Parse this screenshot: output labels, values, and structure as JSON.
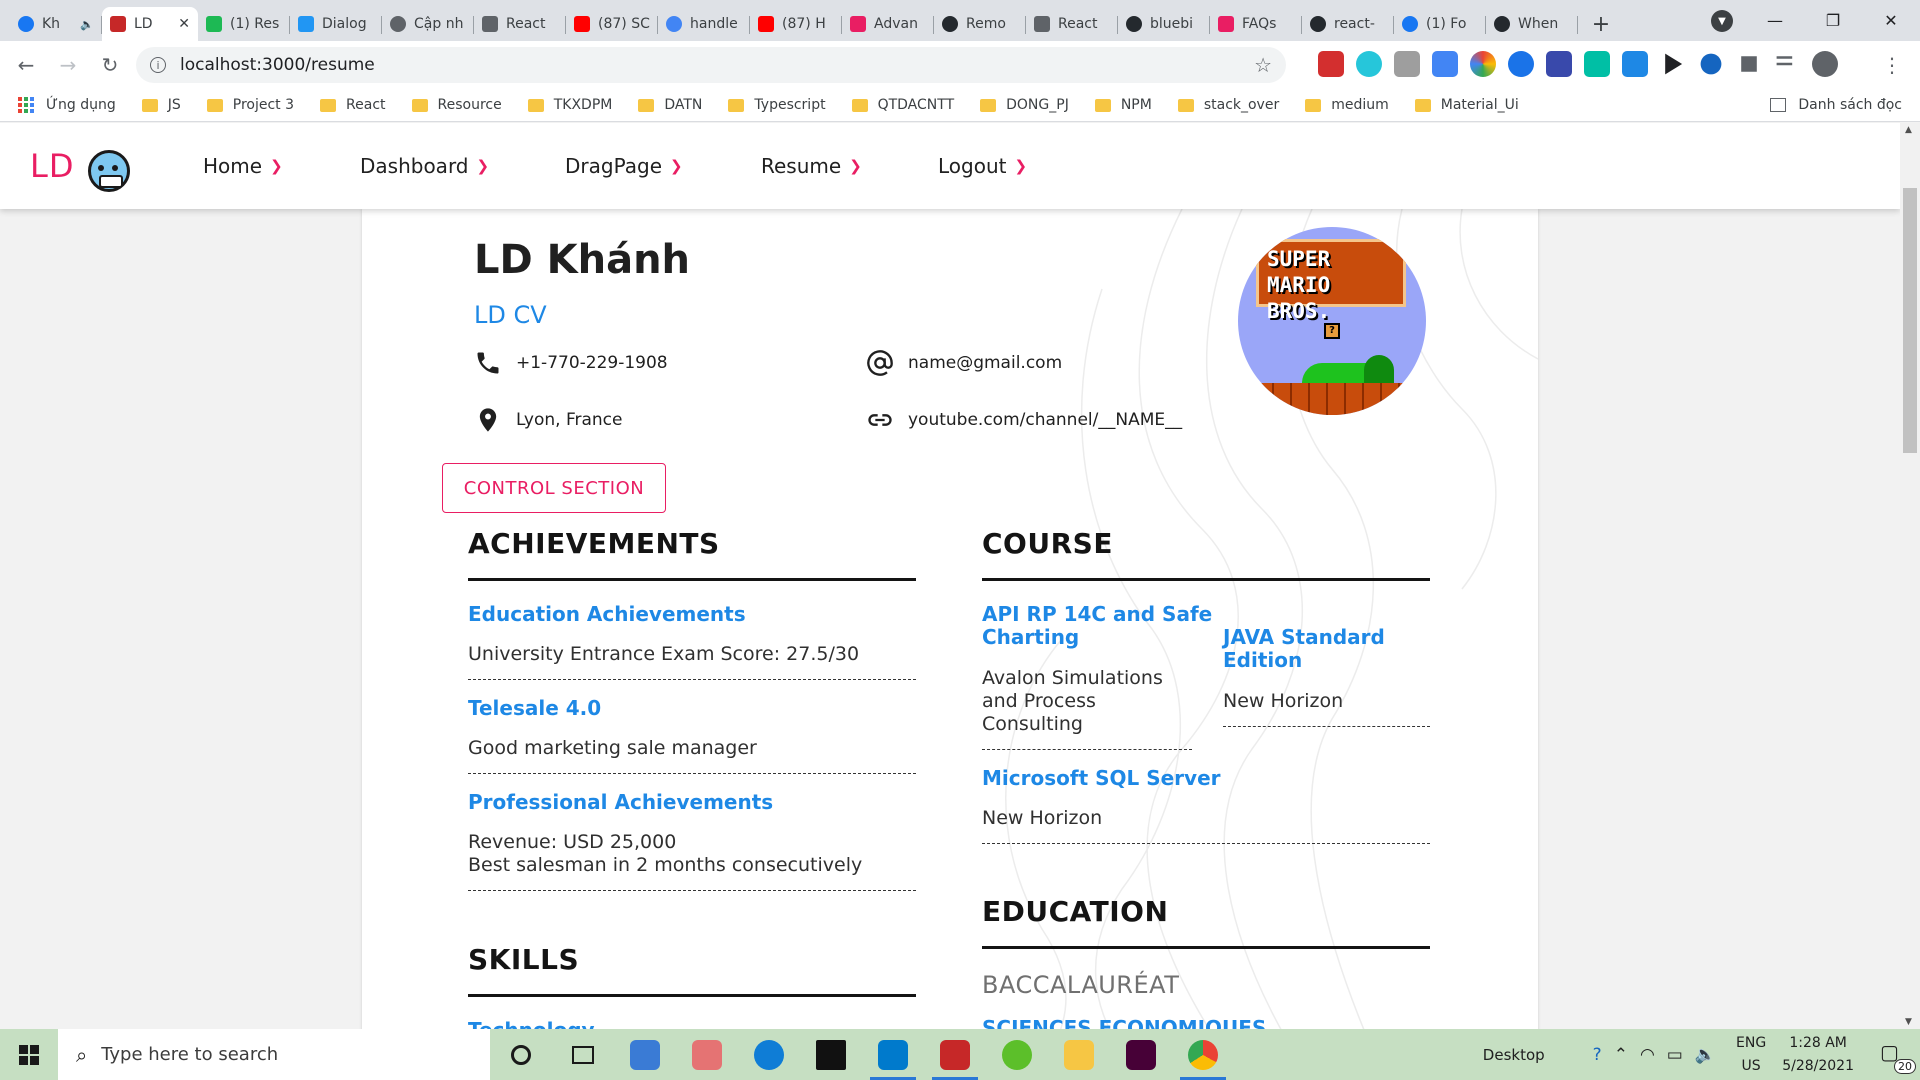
{
  "browser": {
    "tabs": [
      {
        "label": "Kh",
        "color": "#1877f2",
        "audio": "🔈"
      },
      {
        "label": "LD",
        "color": "#c62828",
        "active": true
      },
      {
        "label": "(1) Res",
        "color": "#1db954"
      },
      {
        "label": "Dialog",
        "color": "#2196f3"
      },
      {
        "label": "Cập nh",
        "color": "#5f6368"
      },
      {
        "label": "React",
        "color": "#5f6368"
      },
      {
        "label": "(87) SC",
        "color": "#ff0000"
      },
      {
        "label": "handle",
        "color": "#4285f4"
      },
      {
        "label": "(87) H",
        "color": "#ff0000"
      },
      {
        "label": "Advan",
        "color": "#e91e63"
      },
      {
        "label": "Remo",
        "color": "#24292e"
      },
      {
        "label": "React",
        "color": "#5f6368"
      },
      {
        "label": "bluebi",
        "color": "#24292e"
      },
      {
        "label": "FAQs",
        "color": "#e91e63"
      },
      {
        "label": "react-",
        "color": "#24292e"
      },
      {
        "label": "(1) Fo",
        "color": "#1877f2"
      },
      {
        "label": "When",
        "color": "#24292e"
      }
    ],
    "new_tab": "+",
    "url": "localhost:3000/resume",
    "bookmarks": [
      "Ứng dụng",
      "JS",
      "Project 3",
      "React",
      "Resource",
      "TKXDPM",
      "DATN",
      "Typescript",
      "QTDACNTT",
      "DONG_PJ",
      "NPM",
      "stack_over",
      "medium",
      "Material_Ui"
    ],
    "reading_list": "Danh sách đọc",
    "extension_colors": [
      "#d32f2f",
      "#26c6da",
      "#9e9e9e",
      "#4285f4",
      "#fbbc05",
      "#1a73e8",
      "#3949ab",
      "#00bfa5",
      "#1e88e5",
      "#202124",
      "#1565c0",
      "#5f6368",
      "#5f6368",
      "#5f6368"
    ]
  },
  "app": {
    "logo": "LD",
    "menu": [
      {
        "label": "Home"
      },
      {
        "label": "Dashboard"
      },
      {
        "label": "DragPage"
      },
      {
        "label": "Resume"
      },
      {
        "label": "Logout"
      }
    ],
    "accent_color": "#e91e63",
    "link_color": "#1e88e5"
  },
  "resume": {
    "name": "LD Khánh",
    "subtitle": "LD CV",
    "phone": "+1-770-229-1908",
    "email": "name@gmail.com",
    "location": "Lyon, France",
    "website": "youtube.com/channel/__NAME__",
    "avatar_text": "SUPER MARIO BROS.",
    "control_button": "CONTROL SECTION",
    "achievements": {
      "title": "ACHIEVEMENTS",
      "items": [
        {
          "title": "Education Achievements",
          "lines": [
            "University Entrance Exam Score: 27.5/30"
          ]
        },
        {
          "title": "Telesale 4.0",
          "lines": [
            "Good marketing sale manager"
          ]
        },
        {
          "title": "Professional Achievements",
          "lines": [
            "Revenue: USD 25,000",
            "Best salesman in 2 months consecutively"
          ]
        }
      ]
    },
    "skills": {
      "title": "SKILLS",
      "first_item": "Technology"
    },
    "course": {
      "title": "COURSE",
      "items": [
        {
          "title_lines": [
            "API RP 14C and Safe",
            "Charting"
          ],
          "lines": [
            "Avalon Simulations",
            "and Process",
            "Consulting"
          ]
        },
        {
          "title_lines": [
            "JAVA Standard",
            "Edition"
          ],
          "lines": [
            "New Horizon"
          ]
        },
        {
          "title_lines": [
            "Microsoft SQL Server"
          ],
          "lines": [
            "New Horizon"
          ]
        }
      ]
    },
    "education": {
      "title": "EDUCATION",
      "degree": "BACCALAURÉAT",
      "field": "SCIENCES ECONOMIQUES"
    }
  },
  "taskbar": {
    "search_placeholder": "Type here to search",
    "desktop_label": "Desktop",
    "lang_top": "ENG",
    "lang_bottom": "US",
    "time": "1:28 AM",
    "date": "5/28/2021",
    "notification_count": "20",
    "app_colors": [
      "#222222",
      "#222222",
      "#3a7bd5",
      "#e57373",
      "#0f7dd6",
      "#111111",
      "#007acc",
      "#c62828",
      "#5cbf2a",
      "#f6c644",
      "#470137",
      "#4285f4"
    ]
  }
}
